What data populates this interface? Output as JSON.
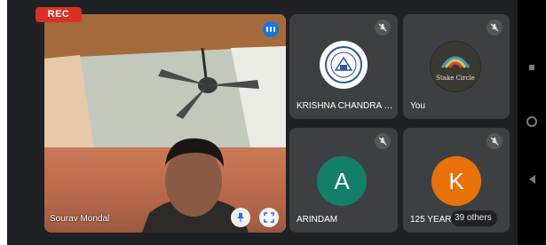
{
  "recording": {
    "label": "REC"
  },
  "main_tile": {
    "participant_name": "Sourav Mondal"
  },
  "tiles": [
    {
      "label": "KRISHNA CHANDRA C...",
      "muted": true,
      "avatar_type": "logo"
    },
    {
      "label": "You",
      "muted": true,
      "avatar_type": "logo",
      "logo_text": "Stake Circle"
    },
    {
      "label": "ARINDAM",
      "muted": true,
      "avatar_letter": "A",
      "avatar_color": "#137e6a"
    },
    {
      "label": "125 YEAR C...",
      "muted": true,
      "avatar_letter": "K",
      "avatar_color": "#e8710a"
    }
  ],
  "others": {
    "label": "39 others"
  },
  "colors": {
    "rec": "#d93025",
    "speaking": "#1a73e8",
    "tile_bg": "#3c4043",
    "call_bg": "#202124"
  }
}
